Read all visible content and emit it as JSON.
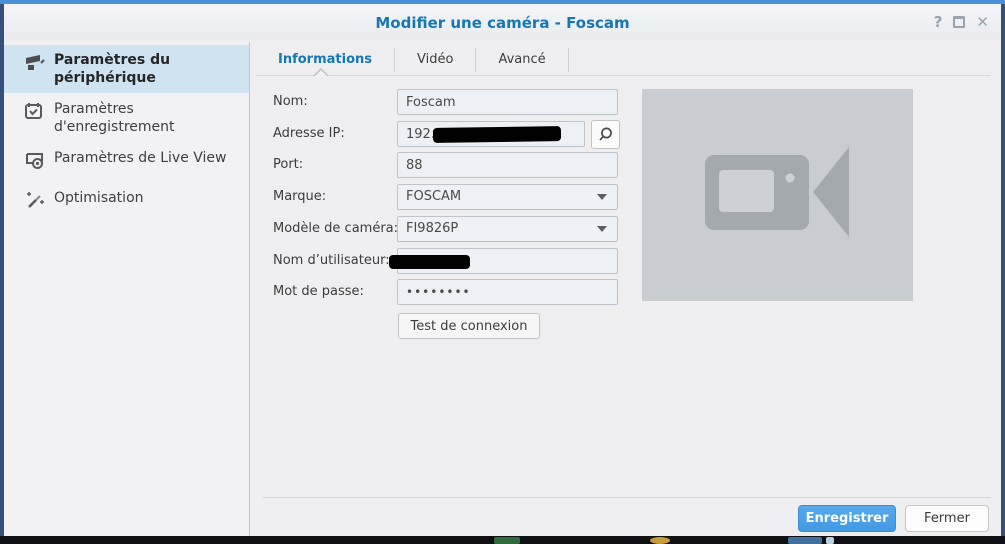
{
  "window": {
    "title": "Modifier une caméra - Foscam",
    "controls": {
      "help_glyph": "?",
      "close_glyph": "✕"
    }
  },
  "sidebar": {
    "items": [
      {
        "label": "Paramètres du périphérique",
        "icon": "device-settings-icon",
        "selected": true
      },
      {
        "label": "Paramètres d'enregistrement",
        "icon": "calendar-check-icon",
        "selected": false
      },
      {
        "label": "Paramètres de Live View",
        "icon": "live-view-icon",
        "selected": false
      },
      {
        "label": "Optimisation",
        "icon": "magic-wand-icon",
        "selected": false
      }
    ]
  },
  "tabs": [
    {
      "label": "Informations",
      "active": true
    },
    {
      "label": "Vidéo",
      "active": false
    },
    {
      "label": "Avancé",
      "active": false
    }
  ],
  "form": {
    "fields": [
      {
        "label": "Nom:",
        "value": "Foscam"
      },
      {
        "label": "Adresse IP:",
        "value": "192.1",
        "note": "partially redacted"
      },
      {
        "label": "Port:",
        "value": "88"
      },
      {
        "label": "Marque:",
        "value": "FOSCAM"
      },
      {
        "label": "Modèle de caméra:",
        "value": "FI9826P"
      },
      {
        "label": "Nom d’utilisateur:",
        "value": "",
        "note": "redacted"
      },
      {
        "label": "Mot de passe:",
        "value": "••••••••"
      }
    ],
    "test_button_label": "Test de connexion"
  },
  "footer": {
    "save_label": "Enregistrer",
    "close_label": "Fermer"
  },
  "colors": {
    "accent_blue": "#1678b0",
    "save_button": "#429ae4",
    "selected_item_bg": "#cfe3f0",
    "top_strip": "#4a90d9",
    "placeholder_bg": "#c9ccd1",
    "placeholder_icon": "#a4a9b0"
  }
}
